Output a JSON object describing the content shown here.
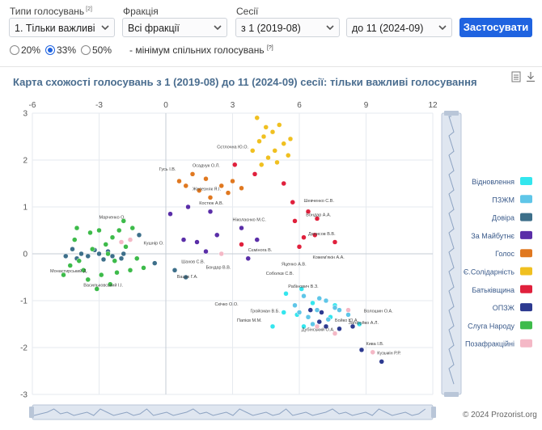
{
  "filters": {
    "vote_type": {
      "label": "Типи голосувань",
      "note": "[2]",
      "value": "1. Тільки важливі"
    },
    "faction": {
      "label": "Фракція",
      "value": "Всі фракції"
    },
    "sessions": {
      "label": "Сесії",
      "from": "з 1 (2019-08)",
      "to": "до 11 (2024-09)"
    },
    "apply_label": "Застосувати",
    "thresholds": [
      {
        "label": "20%",
        "selected": false
      },
      {
        "label": "33%",
        "selected": true
      },
      {
        "label": "50%",
        "selected": false
      }
    ],
    "threshold_note": "- мінімум спільних голосувань",
    "threshold_ref": "[?]"
  },
  "colors": {
    "accent": "#1f63e0",
    "title": "#4a6d8f"
  },
  "chart_data": {
    "type": "scatter",
    "title": "Карта схожості голосувань з 1 (2019-08) до 11 (2024-09) сесії: тільки важливі голосування",
    "xlim": [
      -6,
      12
    ],
    "ylim": [
      -3,
      3
    ],
    "xticks": [
      -6,
      -3,
      0,
      3,
      6,
      9,
      12
    ],
    "yticks": [
      -3,
      -2,
      -1,
      0,
      1,
      2,
      3
    ],
    "grid": true,
    "legend_position": "right",
    "series": [
      {
        "name": "Відновлення",
        "color": "#33e6ee",
        "points": [
          [
            7.6,
            -1.1
          ],
          [
            6.1,
            -0.75
          ],
          [
            5.9,
            -1.3
          ],
          [
            4.8,
            -1.55
          ],
          [
            8.7,
            -1.5
          ],
          [
            5.4,
            -0.85
          ],
          [
            6.6,
            -1.05
          ],
          [
            7.4,
            -1.35
          ],
          [
            6.2,
            -1.55
          ],
          [
            5.3,
            -1.25
          ]
        ]
      },
      {
        "name": "ПЗЖМ",
        "color": "#5fc6e8",
        "points": [
          [
            6.2,
            -0.9
          ],
          [
            6.8,
            -1.2
          ],
          [
            7.2,
            -1.0
          ],
          [
            5.8,
            -1.1
          ],
          [
            6.4,
            -1.35
          ],
          [
            7.6,
            -1.15
          ],
          [
            6.9,
            -0.95
          ],
          [
            7.3,
            -1.4
          ],
          [
            6.0,
            -1.25
          ],
          [
            8.2,
            -1.3
          ],
          [
            7.8,
            -1.2
          ],
          [
            6.6,
            -1.5
          ]
        ]
      },
      {
        "name": "Довіра",
        "color": "#3d6f8a",
        "points": [
          [
            -4.0,
            -0.1
          ],
          [
            -3.5,
            -0.05
          ],
          [
            -3.0,
            0.0
          ],
          [
            -2.6,
            0.05
          ],
          [
            -4.2,
            0.1
          ],
          [
            -2.0,
            -0.1
          ],
          [
            -1.2,
            0.4
          ],
          [
            -0.5,
            -0.2
          ],
          [
            0.4,
            -0.35
          ],
          [
            0.9,
            -0.5
          ],
          [
            -3.8,
            0.0
          ],
          [
            -4.5,
            -0.05
          ],
          [
            -2.4,
            -0.05
          ],
          [
            -3.2,
            0.08
          ],
          [
            -1.9,
            0.0
          ],
          [
            -2.8,
            -0.12
          ]
        ]
      },
      {
        "name": "За Майбутнє",
        "color": "#5a2ea8",
        "points": [
          [
            0.2,
            0.85
          ],
          [
            1.0,
            1.0
          ],
          [
            2.0,
            0.9
          ],
          [
            2.3,
            0.4
          ],
          [
            1.4,
            0.25
          ],
          [
            3.4,
            0.55
          ],
          [
            4.1,
            0.3
          ],
          [
            3.7,
            -0.1
          ],
          [
            0.8,
            0.3
          ],
          [
            1.8,
            0.05
          ]
        ]
      },
      {
        "name": "Голос",
        "color": "#e07820",
        "points": [
          [
            1.2,
            1.7
          ],
          [
            0.6,
            1.55
          ],
          [
            1.8,
            1.6
          ],
          [
            2.5,
            1.45
          ],
          [
            1.5,
            1.35
          ],
          [
            3.4,
            1.4
          ],
          [
            2.8,
            1.3
          ],
          [
            0.9,
            1.45
          ],
          [
            2.0,
            1.2
          ],
          [
            3.0,
            1.55
          ]
        ]
      },
      {
        "name": "Є.Солідарність",
        "color": "#f0c020",
        "points": [
          [
            4.1,
            2.9
          ],
          [
            4.5,
            2.7
          ],
          [
            5.1,
            2.75
          ],
          [
            4.4,
            2.5
          ],
          [
            5.3,
            2.35
          ],
          [
            4.9,
            2.2
          ],
          [
            5.5,
            2.1
          ],
          [
            4.6,
            2.05
          ],
          [
            5.0,
            1.95
          ],
          [
            4.2,
            2.4
          ],
          [
            4.8,
            2.6
          ],
          [
            5.6,
            2.45
          ],
          [
            4.3,
            1.9
          ],
          [
            3.9,
            2.2
          ]
        ]
      },
      {
        "name": "Батьківщина",
        "color": "#e0203c",
        "points": [
          [
            3.1,
            1.9
          ],
          [
            4.0,
            1.7
          ],
          [
            5.3,
            1.5
          ],
          [
            5.7,
            1.1
          ],
          [
            6.4,
            0.9
          ],
          [
            6.8,
            0.75
          ],
          [
            5.8,
            0.7
          ],
          [
            6.2,
            0.35
          ],
          [
            7.6,
            0.25
          ],
          [
            6.0,
            0.15
          ],
          [
            3.4,
            0.2
          ],
          [
            6.7,
            0.4
          ]
        ]
      },
      {
        "name": "ОПЗЖ",
        "color": "#2d3a90",
        "points": [
          [
            9.7,
            -2.3
          ],
          [
            8.8,
            -2.05
          ],
          [
            7.8,
            -1.6
          ],
          [
            8.4,
            -1.55
          ],
          [
            7.2,
            -1.55
          ],
          [
            6.9,
            -1.45
          ],
          [
            7.0,
            -1.25
          ],
          [
            6.5,
            -1.2
          ]
        ]
      },
      {
        "name": "Слуга Народу",
        "color": "#3dbb4a",
        "points": [
          [
            -3.0,
            0.5
          ],
          [
            -2.4,
            0.35
          ],
          [
            -1.9,
            0.7
          ],
          [
            -1.5,
            0.55
          ],
          [
            -2.7,
            0.2
          ],
          [
            -2.0,
            0.25
          ],
          [
            -3.4,
            0.45
          ],
          [
            -4.1,
            0.3
          ],
          [
            -3.7,
            -0.35
          ],
          [
            -2.9,
            -0.45
          ],
          [
            -2.2,
            -0.4
          ],
          [
            -3.1,
            -0.75
          ],
          [
            -1.6,
            -0.35
          ],
          [
            -4.3,
            -0.25
          ],
          [
            -4.6,
            -0.45
          ],
          [
            -2.5,
            -0.65
          ],
          [
            -3.5,
            -0.55
          ],
          [
            -1.8,
            0.15
          ],
          [
            -2.3,
            -0.15
          ],
          [
            -3.3,
            0.1
          ],
          [
            -1.3,
            -0.1
          ],
          [
            -2.6,
            0.0
          ],
          [
            -3.9,
            -0.15
          ],
          [
            -2.1,
            0.5
          ],
          [
            -1.0,
            -0.3
          ],
          [
            -4.0,
            0.55
          ]
        ]
      },
      {
        "name": "Позафракційні",
        "color": "#f4b8c6",
        "points": [
          [
            7.6,
            -1.7
          ],
          [
            9.3,
            -2.1
          ],
          [
            8.2,
            -1.2
          ],
          [
            -2.0,
            0.25
          ],
          [
            -1.6,
            0.3
          ],
          [
            6.8,
            -1.55
          ],
          [
            2.5,
            0.0
          ]
        ]
      }
    ],
    "labels": [
      {
        "text": "Сєтлочна Ю.О.",
        "x": 2.3,
        "y": 2.25
      },
      {
        "text": "Осадчук О.Л.",
        "x": 1.2,
        "y": 1.85
      },
      {
        "text": "Гусь І.В.",
        "x": -0.3,
        "y": 1.78
      },
      {
        "text": "Железняк Я.І.",
        "x": 1.2,
        "y": 1.35
      },
      {
        "text": "Шевченко С.В.",
        "x": 6.2,
        "y": 1.1
      },
      {
        "text": "Бондар А.А.",
        "x": 6.3,
        "y": 0.8
      },
      {
        "text": "Денисов В.В.",
        "x": 6.4,
        "y": 0.4
      },
      {
        "text": "Костюк А.В.",
        "x": 1.5,
        "y": 1.05
      },
      {
        "text": "Ніколаєнко М.С.",
        "x": 3.0,
        "y": 0.7
      },
      {
        "text": "Сємінога В.",
        "x": 3.7,
        "y": 0.05
      },
      {
        "text": "Яценко А.В.",
        "x": 5.2,
        "y": -0.25
      },
      {
        "text": "Кожем'якін А.А.",
        "x": 6.6,
        "y": -0.1
      },
      {
        "text": "Шахов С.В.",
        "x": 0.7,
        "y": -0.2
      },
      {
        "text": "Вацак Г.А.",
        "x": 0.5,
        "y": -0.52
      },
      {
        "text": "Бондар В.В.",
        "x": 1.8,
        "y": -0.32
      },
      {
        "text": "Соболєв С.В.",
        "x": 4.5,
        "y": -0.45
      },
      {
        "text": "Рабінович В.З.",
        "x": 5.5,
        "y": -0.72
      },
      {
        "text": "Васильковський І.І.",
        "x": -3.7,
        "y": -0.7
      },
      {
        "text": "Монастирський Д.",
        "x": -5.2,
        "y": -0.4
      },
      {
        "text": "Скічко О.О.",
        "x": 2.2,
        "y": -1.1
      },
      {
        "text": "Гройсман В.Б.",
        "x": 3.8,
        "y": -1.25
      },
      {
        "text": "Папієв М.М.",
        "x": 3.2,
        "y": -1.45
      },
      {
        "text": "Дубінський О.А.",
        "x": 6.1,
        "y": -1.65
      },
      {
        "text": "Бойко Ю.А.",
        "x": 7.6,
        "y": -1.45
      },
      {
        "text": "Волошин О.А.",
        "x": 8.9,
        "y": -1.25
      },
      {
        "text": "Загоруйко А.Л.",
        "x": 8.2,
        "y": -1.5
      },
      {
        "text": "Кива І.В.",
        "x": 9.0,
        "y": -1.95
      },
      {
        "text": "Кузьмін Р.Р.",
        "x": 9.5,
        "y": -2.15
      },
      {
        "text": "Марченко О.",
        "x": -3.0,
        "y": 0.75
      },
      {
        "text": "Кушнір О.",
        "x": -1.0,
        "y": 0.2
      }
    ]
  },
  "copyright": "© 2024 Prozorist.org"
}
